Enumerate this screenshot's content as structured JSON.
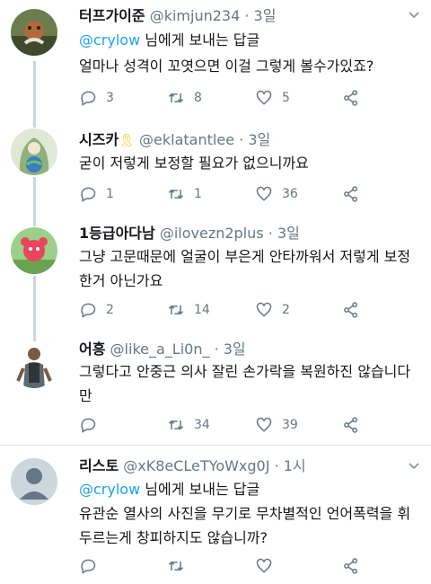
{
  "tweets": [
    {
      "name": "터프가이준",
      "handle": "@kimjun234",
      "time": "3일",
      "reply_prefix": "@crylow",
      "reply_suffix": " 님에게 보내는 답글",
      "text": "얼마나 성격이 꼬엿으면 이걸 그렇게 볼수가있죠?",
      "replies": "3",
      "retweets": "8",
      "likes": "5"
    },
    {
      "name": "시즈카",
      "badge_icon": "yellow-ribbon-icon",
      "handle": "@eklatantlee",
      "time": "3일",
      "text": "굳이 저렇게 보정할 필요가 없으니까요",
      "replies": "1",
      "retweets": "1",
      "likes": "36"
    },
    {
      "name": "1등급아다남",
      "handle": "@ilovezn2plus",
      "time": "3일",
      "text": "그냥 고문때문에 얼굴이 부은게 안타까워서 저렇게 보정한거 아닌가요",
      "replies": "2",
      "retweets": "14",
      "likes": "2"
    },
    {
      "name": "어흥",
      "handle": "@like_a_Li0n_",
      "time": "3일",
      "text": "그렇다고 안중근 의사 잘린 손가락을 복원하진 않습니다만",
      "replies": "",
      "retweets": "34",
      "likes": "39"
    },
    {
      "name": "리스토",
      "handle": "@xK8eCLeTYoWxg0J",
      "time": "1시",
      "reply_prefix": "@crylow",
      "reply_suffix": " 님에게 보내는 답글",
      "text": "유관순 열사의 사진을 무기로 무차별적인 언어폭력을 휘두르는게 창피하지도 않습니까?",
      "replies": "",
      "retweets": "",
      "likes": ""
    }
  ],
  "separator": "·",
  "colors": {
    "link": "#1da1f2",
    "secondary_text": "#657786",
    "thread_line": "#ccd6dd",
    "divider": "#e1e8ed"
  }
}
